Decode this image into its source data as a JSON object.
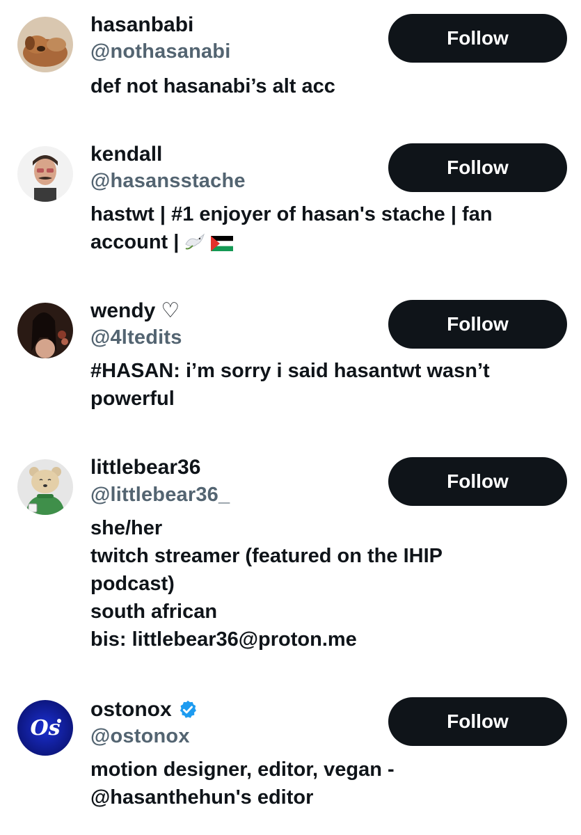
{
  "users": [
    {
      "display_name": "hasanbabi",
      "name_suffix": "",
      "verified": false,
      "handle": "@nothasanabi",
      "bio_lines": [
        "def not hasanabi’s alt acc"
      ],
      "follow_label": "Follow",
      "avatar_icon": "dog-avatar"
    },
    {
      "display_name": "kendall",
      "name_suffix": "",
      "verified": false,
      "handle": "@hasansstache",
      "bio_lines": [
        "hastwt | #1 enjoyer of hasan's stache | fan",
        "account |"
      ],
      "follow_label": "Follow",
      "avatar_icon": "man-avatar"
    },
    {
      "display_name": "wendy",
      "name_suffix": "♡",
      "verified": false,
      "handle": "@4ltedits",
      "bio_lines": [
        "#HASAN: i’m sorry i said hasantwt wasn’t",
        "powerful"
      ],
      "follow_label": "Follow",
      "avatar_icon": "woman-avatar"
    },
    {
      "display_name": "littlebear36",
      "name_suffix": "",
      "verified": false,
      "handle": "@littlebear36_",
      "bio_lines": [
        "she/her",
        "twitch streamer (featured on the IHIP",
        "podcast)",
        "south african",
        "bis: littlebear36@proton.me"
      ],
      "follow_label": "Follow",
      "avatar_icon": "bear-avatar"
    },
    {
      "display_name": "ostonox",
      "name_suffix": "",
      "verified": true,
      "handle": "@ostonox",
      "bio_lines": [
        "motion designer, editor, vegan -",
        "@hasanthehun's editor"
      ],
      "follow_label": "Follow",
      "avatar_icon": "os-logo-avatar"
    }
  ],
  "colors": {
    "text": "#0f1419",
    "handle": "#536471",
    "button_bg": "#0f1419",
    "button_text": "#ffffff",
    "verified_badge": "#1d9bf0"
  }
}
